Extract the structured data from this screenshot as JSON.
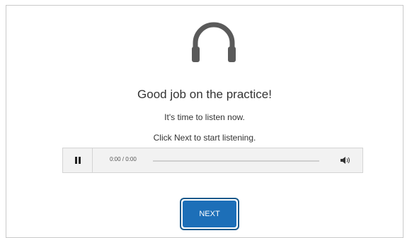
{
  "message": {
    "title": "Good job on the practice!",
    "line1": "It's time to listen now.",
    "line2": "Click Next to start listening."
  },
  "player": {
    "time": "0:00 / 0:00",
    "progress": 0
  },
  "next_button": {
    "label": "NEXT"
  },
  "colors": {
    "button": "#1d6fb8",
    "icon": "#5a5a5a"
  },
  "icons": [
    "headphones-icon",
    "pause-icon",
    "volume-icon"
  ]
}
